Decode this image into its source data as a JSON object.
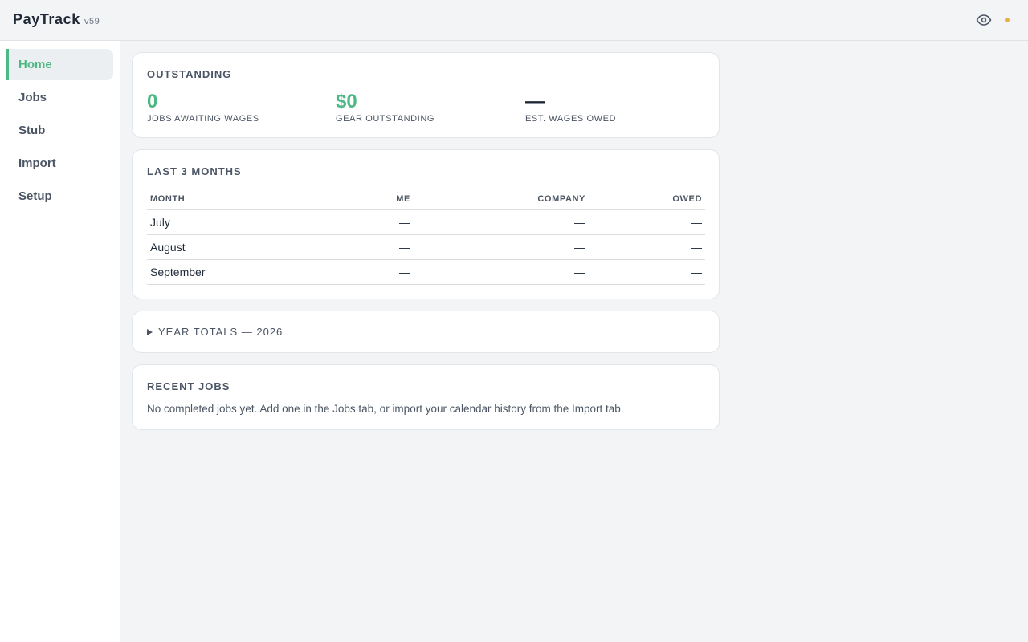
{
  "app": {
    "name": "PayTrack",
    "version": "v59"
  },
  "header": {
    "eye_icon": "eye-icon",
    "status_color": "#e8b04a"
  },
  "sidebar": {
    "items": [
      {
        "label": "Home",
        "active": true
      },
      {
        "label": "Jobs",
        "active": false
      },
      {
        "label": "Stub",
        "active": false
      },
      {
        "label": "Import",
        "active": false
      },
      {
        "label": "Setup",
        "active": false
      }
    ]
  },
  "outstanding": {
    "title": "OUTSTANDING",
    "stats": [
      {
        "value": "0",
        "label": "JOBS AWAITING WAGES"
      },
      {
        "value": "$0",
        "label": "GEAR OUTSTANDING"
      },
      {
        "value": "—",
        "label": "EST. WAGES OWED"
      }
    ]
  },
  "last3": {
    "title": "LAST 3 MONTHS",
    "columns": [
      "MONTH",
      "ME",
      "COMPANY",
      "OWED"
    ],
    "rows": [
      [
        "July",
        "—",
        "—",
        "—"
      ],
      [
        "August",
        "—",
        "—",
        "—"
      ],
      [
        "September",
        "—",
        "—",
        "—"
      ]
    ]
  },
  "year_totals": {
    "label": "YEAR TOTALS — 2026",
    "expanded": false
  },
  "recent_jobs": {
    "title": "RECENT JOBS",
    "empty_text": "No completed jobs yet. Add one in the Jobs tab, or import your calendar history from the Import tab."
  },
  "colors": {
    "accent": "#4cb883",
    "status": "#e8b04a",
    "text": "#1f2937",
    "muted": "#4b5563"
  }
}
